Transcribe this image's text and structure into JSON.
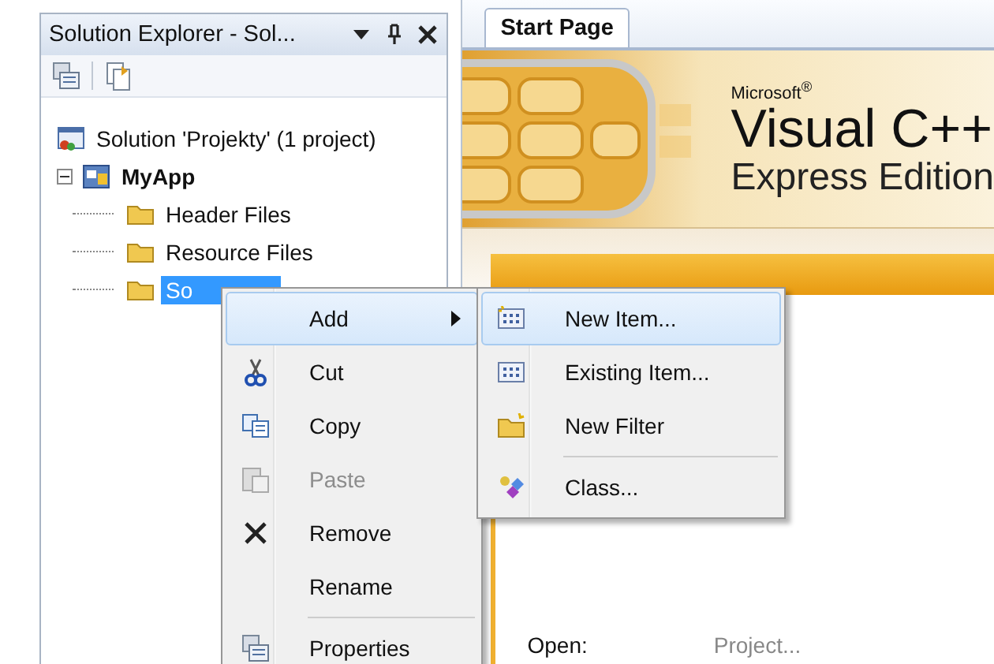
{
  "solution_explorer": {
    "title": "Solution Explorer - Sol...",
    "tree": [
      {
        "label": "Solution 'Projekty' (1 project)",
        "selected": false,
        "children": [
          {
            "label": "MyApp",
            "expanded": true,
            "selected": false,
            "children": [
              {
                "label": "Header Files",
                "selected": false
              },
              {
                "label": "Resource Files",
                "selected": false
              },
              {
                "label": "So",
                "selected": true
              }
            ]
          }
        ]
      }
    ]
  },
  "editor": {
    "tabs": [
      {
        "label": "Start Page",
        "selected": true
      }
    ],
    "banner": {
      "brand": "Microsoft$^{®}$",
      "product": "Visual C++",
      "edition": "Express Edition"
    },
    "open_label": "Open:",
    "open_link": "Project..."
  },
  "context_menu": [
    {
      "kind": "add",
      "label": "Add",
      "submenu": true,
      "selected": true,
      "disabled": false
    },
    {
      "kind": "cut",
      "label": "Cut",
      "submenu": false,
      "selected": false,
      "disabled": false
    },
    {
      "kind": "copy",
      "label": "Copy",
      "submenu": false,
      "selected": false,
      "disabled": false
    },
    {
      "kind": "paste",
      "label": "Paste",
      "submenu": false,
      "selected": false,
      "disabled": true
    },
    {
      "kind": "remove",
      "label": "Remove",
      "submenu": false,
      "selected": false,
      "disabled": false
    },
    {
      "kind": "rename",
      "label": "Rename",
      "submenu": false,
      "selected": false,
      "disabled": false
    },
    {
      "kind": "separator"
    },
    {
      "kind": "properties",
      "label": "Properties",
      "submenu": false,
      "selected": false,
      "disabled": false
    }
  ],
  "submenu": [
    {
      "kind": "new-item",
      "label": "New Item...",
      "selected": true
    },
    {
      "kind": "existing-item",
      "label": "Existing Item...",
      "selected": false
    },
    {
      "kind": "new-filter",
      "label": "New Filter",
      "selected": false
    },
    {
      "kind": "separator"
    },
    {
      "kind": "class",
      "label": "Class...",
      "selected": false
    }
  ]
}
